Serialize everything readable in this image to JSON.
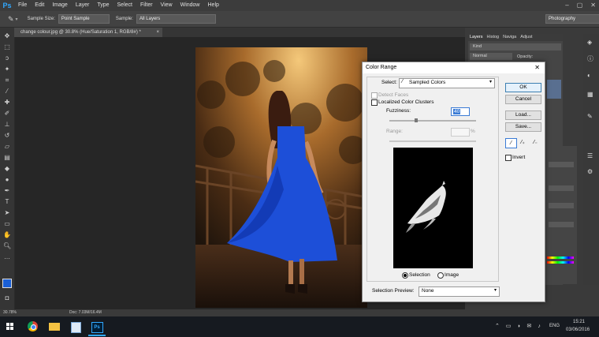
{
  "app": {
    "logo": "Ps"
  },
  "menu": [
    "File",
    "Edit",
    "Image",
    "Layer",
    "Type",
    "Select",
    "Filter",
    "View",
    "Window",
    "Help"
  ],
  "options_bar": {
    "sample_size_label": "Sample Size:",
    "sample_size_value": "Point Sample",
    "sample_label": "Sample:",
    "sample_value": "All Layers",
    "workspace": "Photography"
  },
  "document_tab": "change colour.jpg @ 30.8% (Hue/Saturation 1, RGB/8#) *",
  "status": {
    "zoom": "30.78%",
    "doc": "Doc: 7.03M/16.4M"
  },
  "panels": {
    "tabs": [
      "Layers",
      "Histog",
      "Naviga",
      "Adjust"
    ],
    "kind": "Kind",
    "blend": "Normal",
    "opacity_label": "Opacity:"
  },
  "dialog": {
    "title": "Color Range",
    "close": "✕",
    "select_label": "Select:",
    "select_value": "Sampled Colors",
    "detect_faces": "Detect Faces",
    "localized": "Localized Color Clusters",
    "fuzziness_label": "Fuzziness:",
    "fuzziness_value": "40",
    "range_label": "Range:",
    "range_unit": "%",
    "selection_radio": "Selection",
    "image_radio": "Image",
    "preview_label": "Selection Preview:",
    "preview_value": "None",
    "buttons": {
      "ok": "OK",
      "cancel": "Cancel",
      "load": "Load...",
      "save": "Save..."
    },
    "invert": "Invert"
  },
  "taskbar": {
    "lang": "ENG",
    "time": "15:21",
    "date": "03/06/2016"
  },
  "colors": {
    "foreground": "#1a5fd6",
    "background": "#111111",
    "accent": "#31a8ff"
  }
}
